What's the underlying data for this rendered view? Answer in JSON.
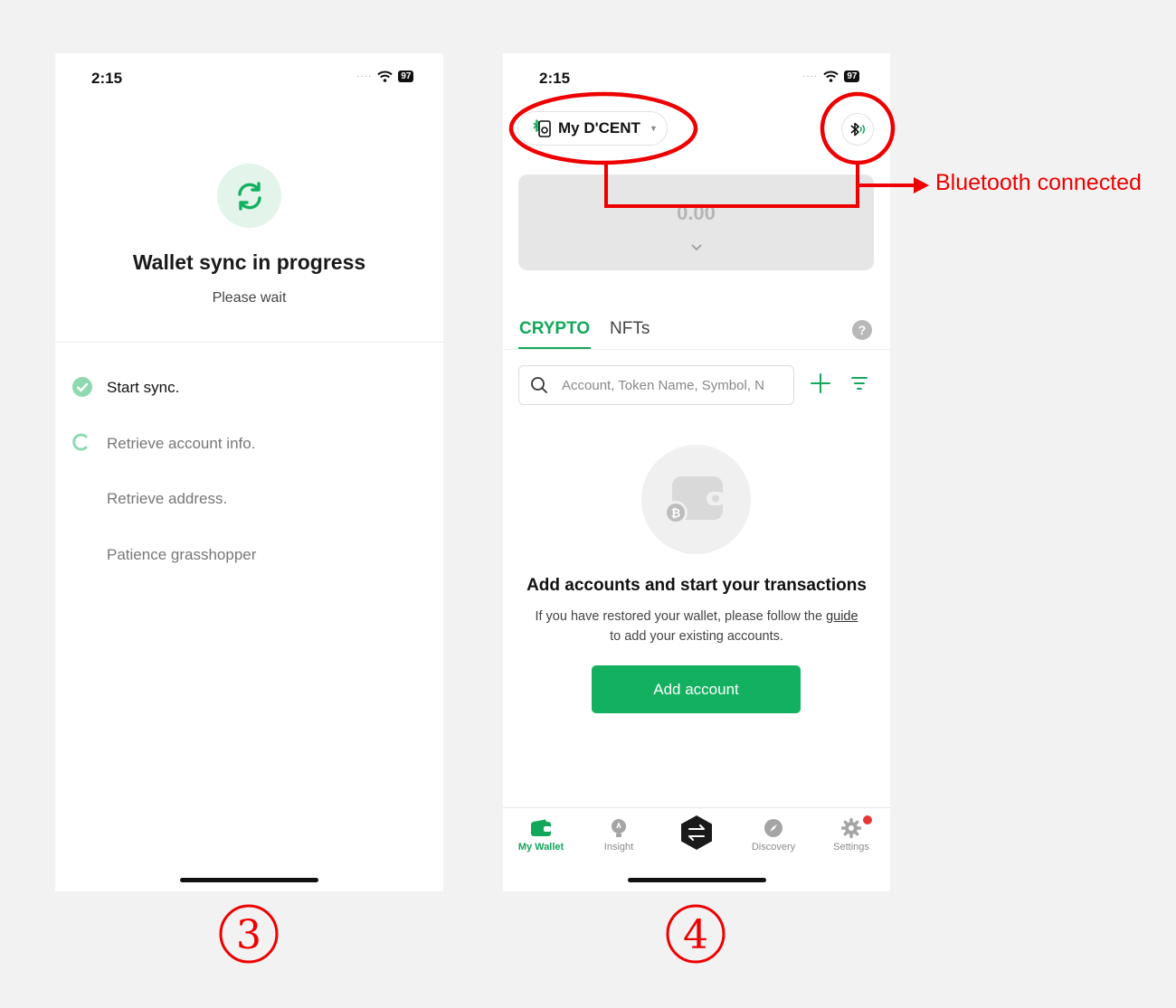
{
  "status_bar": {
    "time": "2:15",
    "battery": "97"
  },
  "sync_screen": {
    "title": "Wallet sync in progress",
    "subtitle": "Please wait",
    "steps": [
      {
        "label": "Start sync.",
        "state": "done"
      },
      {
        "label": "Retrieve account info.",
        "state": "in-progress"
      },
      {
        "label": "Retrieve address.",
        "state": "pending"
      },
      {
        "label": "Patience grasshopper",
        "state": "pending"
      }
    ]
  },
  "wallet_screen": {
    "wallet_selector": "My D'CENT",
    "balance": "0.00",
    "tabs": [
      {
        "label": "CRYPTO",
        "active": true
      },
      {
        "label": "NFTs",
        "active": false
      }
    ],
    "help": "?",
    "search_placeholder": "Account, Token Name, Symbol, N",
    "empty_title": "Add accounts and start your transactions",
    "empty_desc_before": "If you have restored your wallet, please follow the",
    "empty_desc_link": "guide",
    "empty_desc_after": "to add your existing accounts.",
    "add_button": "Add account",
    "nav": [
      {
        "label": "My Wallet",
        "icon": "wallet-icon",
        "active": true
      },
      {
        "label": "Insight",
        "icon": "lightbulb-icon",
        "active": false
      },
      {
        "label": "",
        "icon": "swap-icon",
        "active": false
      },
      {
        "label": "Discovery",
        "icon": "compass-icon",
        "active": false
      },
      {
        "label": "Settings",
        "icon": "gear-icon",
        "active": false
      }
    ]
  },
  "annotations": {
    "bluetooth_label": "Bluetooth connected",
    "step_3": "3",
    "step_4": "4",
    "highlight_color": "#e00000"
  },
  "colors": {
    "accent": "#12a85a",
    "button": "#12b05f"
  }
}
